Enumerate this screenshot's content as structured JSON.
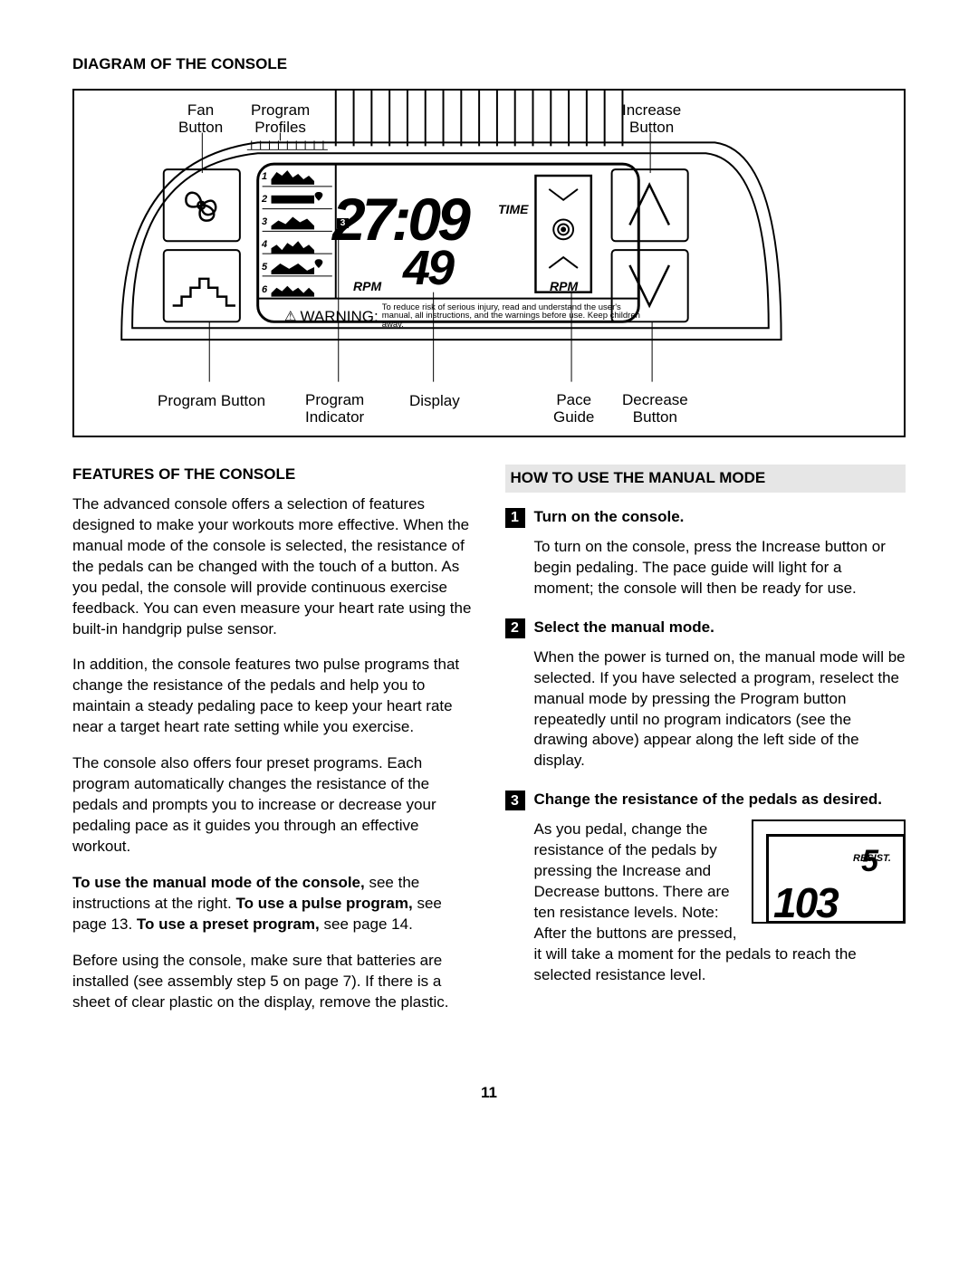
{
  "page_number": "11",
  "heading_diagram": "DIAGRAM OF THE CONSOLE",
  "labels": {
    "fan_button": "Fan\nButton",
    "program_profiles": "Program\nProfiles",
    "increase_button": "Increase\nButton",
    "program_button": "Program Button",
    "program_indicator": "Program\nIndicator",
    "display": "Display",
    "pace_guide": "Pace\nGuide",
    "decrease_button": "Decrease\nButton"
  },
  "lcd": {
    "time_value": "27:09",
    "rpm_value": "49",
    "time_label": "TIME",
    "rpm_label": "RPM",
    "indicator_num": "3",
    "profile_numbers": [
      "1",
      "2",
      "3",
      "4",
      "5",
      "6"
    ]
  },
  "warning": {
    "word": "WARNING:",
    "text": "To reduce risk of serious injury, read and understand the user's manual, all instructions, and the warnings before use. Keep children away."
  },
  "features": {
    "heading": "FEATURES OF THE CONSOLE",
    "p1": "The advanced console offers a selection of features designed to make your workouts more effective. When the manual mode of the console is selected, the resistance of the pedals can be changed with the touch of a button. As you pedal, the console will provide continuous exercise feedback. You can even measure your heart rate using the built-in handgrip pulse sensor.",
    "p2": "In addition, the console features two pulse programs that change the resistance of the pedals and help you to maintain a steady pedaling pace to keep your heart rate near a target heart rate setting while you exercise.",
    "p3": "The console also offers four preset programs. Each program automatically changes the resistance of the pedals and prompts you to increase or decrease your pedaling pace as it guides you through an effective workout.",
    "p4a": "To use the manual mode of the console,",
    "p4b": " see the instructions at the right. ",
    "p4c": "To use a pulse program,",
    "p4d": " see page 13. ",
    "p4e": "To use a preset program,",
    "p4f": " see page 14.",
    "p5": "Before using the console, make sure that batteries are installed (see assembly step 5 on page 7). If there is a sheet of clear plastic on the display, remove the plastic."
  },
  "manual": {
    "heading": "HOW TO USE THE MANUAL MODE",
    "step1_head": "Turn on the console.",
    "step1_body": "To turn on the console, press the Increase button or begin pedaling. The pace guide will light for a moment; the console will then be ready for use.",
    "step2_head": "Select the manual mode.",
    "step2_body": "When the power is turned on, the manual mode will be selected. If you have selected a program, reselect the manual mode by pressing the Program button repeatedly until no program indicators (see the drawing above) appear along the left side of the display.",
    "step3_head": "Change the resistance of the pedals as desired.",
    "step3_body_a": "As you pedal, change the resistance of the pedals by pressing the Increase and Decrease buttons. There are ten resis",
    "step3_body_b": "tance levels. Note: After the buttons are pressed, it will take a moment for the pedals to reach the selected resistance level.",
    "resist_label": "RESIST.",
    "resist_digits": "103",
    "resist_five": "5",
    "nums": {
      "n1": "1",
      "n2": "2",
      "n3": "3"
    }
  }
}
